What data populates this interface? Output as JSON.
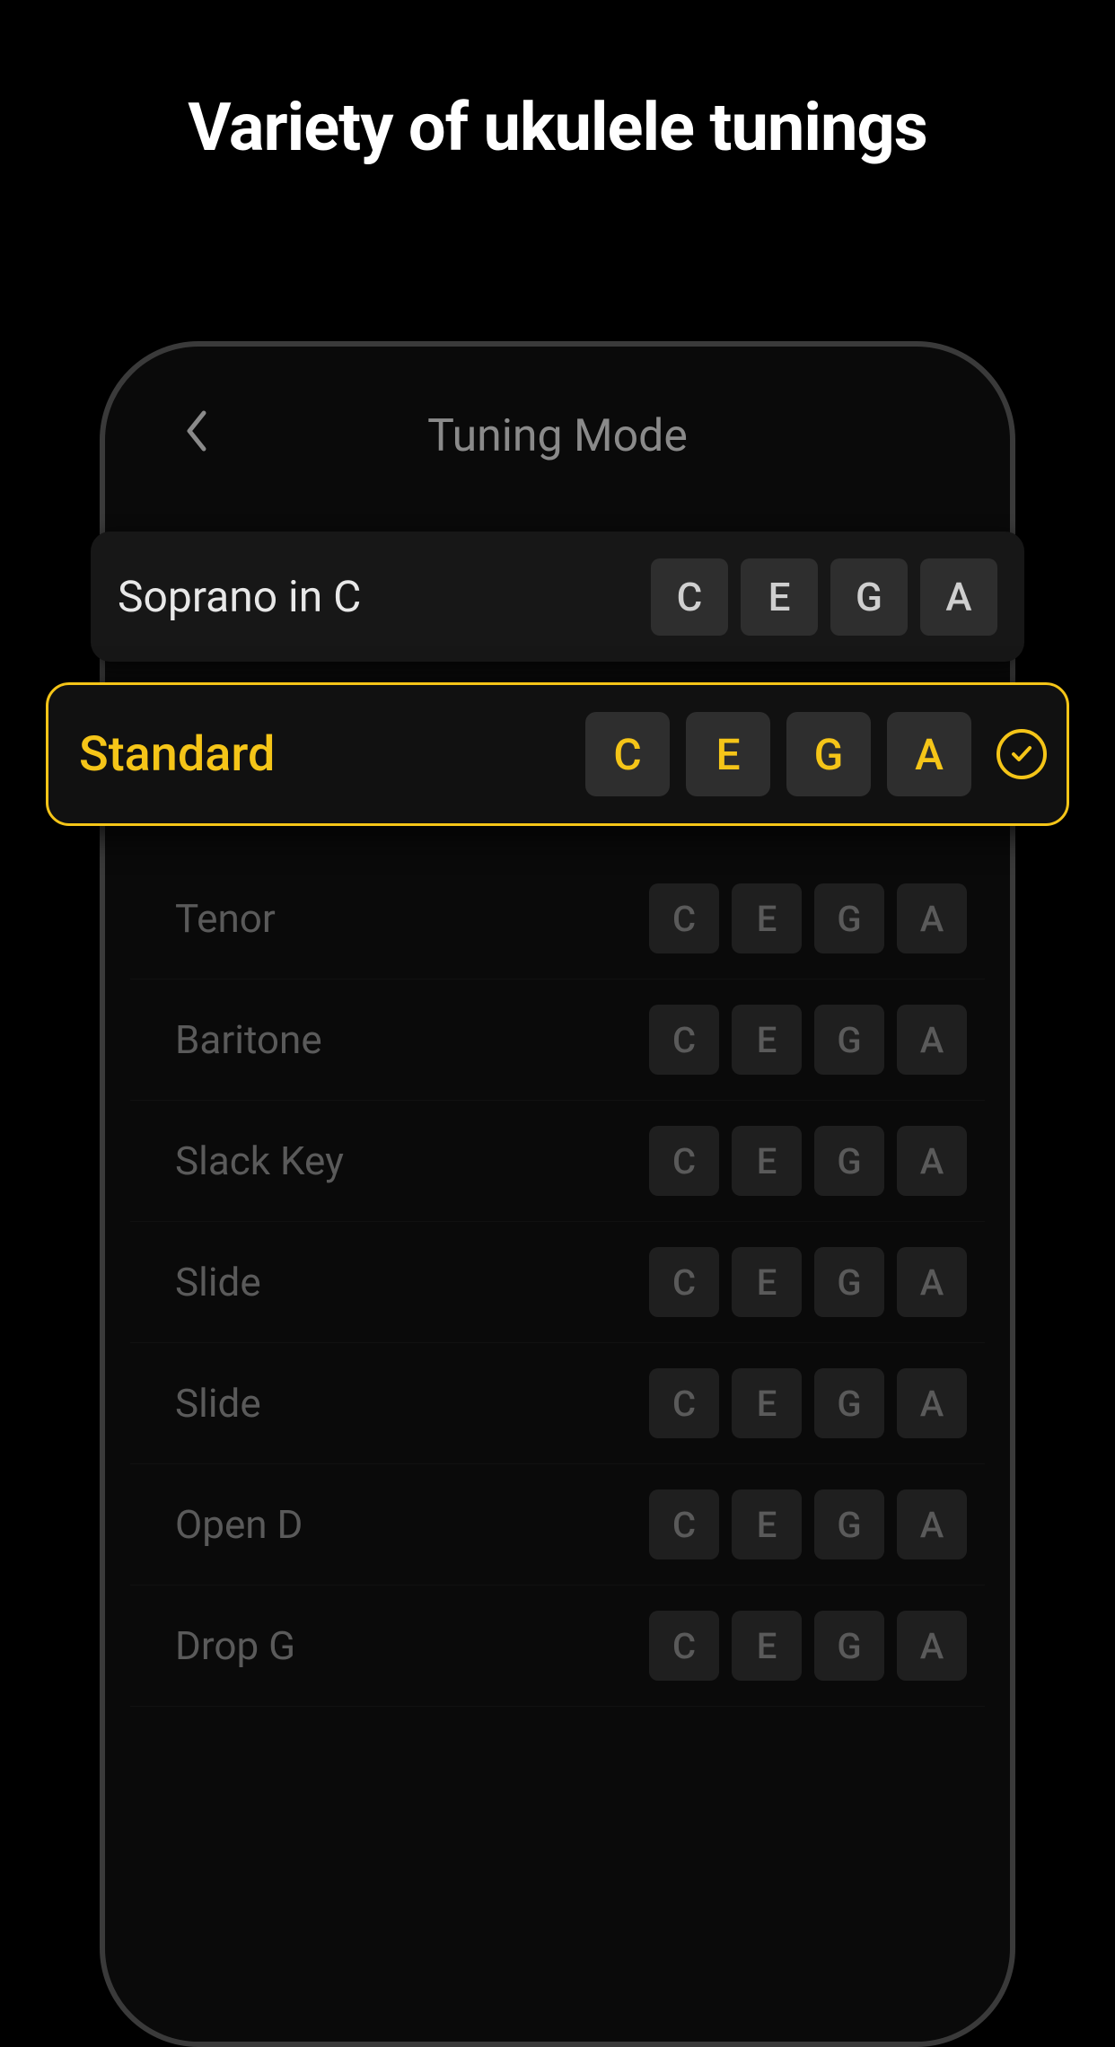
{
  "headline": "Variety of ukulele tunings",
  "nav": {
    "title": "Tuning Mode"
  },
  "highlighted": {
    "label": "Soprano in C",
    "notes": [
      "C",
      "E",
      "G",
      "A"
    ]
  },
  "selected": {
    "label": "Standard",
    "notes": [
      "C",
      "E",
      "G",
      "A"
    ]
  },
  "rows": [
    {
      "label": "Tenor",
      "notes": [
        "C",
        "E",
        "G",
        "A"
      ]
    },
    {
      "label": "Baritone",
      "notes": [
        "C",
        "E",
        "G",
        "A"
      ]
    },
    {
      "label": "Slack Key",
      "notes": [
        "C",
        "E",
        "G",
        "A"
      ]
    },
    {
      "label": "Slide",
      "notes": [
        "C",
        "E",
        "G",
        "A"
      ]
    },
    {
      "label": "Slide",
      "notes": [
        "C",
        "E",
        "G",
        "A"
      ]
    },
    {
      "label": "Open D",
      "notes": [
        "C",
        "E",
        "G",
        "A"
      ]
    },
    {
      "label": "Drop G",
      "notes": [
        "C",
        "E",
        "G",
        "A"
      ]
    }
  ],
  "colors": {
    "accent": "#f5c518"
  }
}
